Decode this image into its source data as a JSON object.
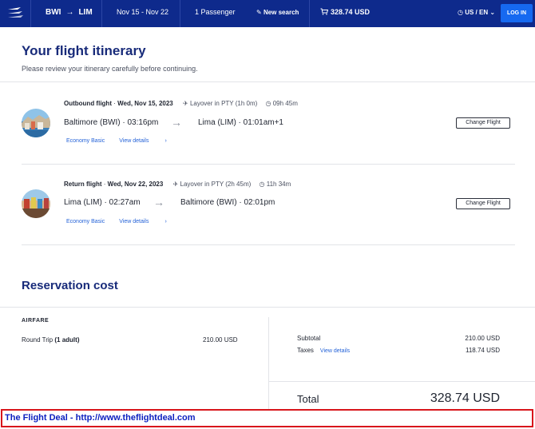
{
  "header": {
    "origin": "BWI",
    "destination": "LIM",
    "dates": "Nov 15 - Nov 22",
    "passengers": "1 Passenger",
    "new_search": "New search",
    "cart_total": "328.74 USD",
    "language": "US / EN",
    "login": "LOG IN",
    "brand_color": "#0e2a8c"
  },
  "itinerary": {
    "title": "Your flight itinerary",
    "subtitle": "Please review your itinerary carefully before continuing."
  },
  "flights": [
    {
      "label": "Outbound flight",
      "date": "Wed, Nov 15, 2023",
      "layover": "Layover in PTY (1h 0m)",
      "duration": "09h 45m",
      "from": "Baltimore (BWI) · 03:16pm",
      "to": "Lima (LIM) · 01:01am+1",
      "fare": "Economy Basic",
      "details": "View details",
      "change": "Change Flight"
    },
    {
      "label": "Return flight",
      "date": "Wed, Nov 22, 2023",
      "layover": "Layover in PTY (2h 45m)",
      "duration": "11h 34m",
      "from": "Lima (LIM) · 02:27am",
      "to": "Baltimore (BWI) · 02:01pm",
      "fare": "Economy Basic",
      "details": "View details",
      "change": "Change Flight"
    }
  ],
  "cost": {
    "title": "Reservation cost",
    "airfare_label": "AIRFARE",
    "round_trip_label": "Round Trip",
    "round_trip_pax": "(1 adult)",
    "round_trip_value": "210.00 USD",
    "subtotal_label": "Subtotal",
    "subtotal_value": "210.00 USD",
    "taxes_label": "Taxes",
    "taxes_link": "View details",
    "taxes_value": "118.74 USD",
    "total_label": "Total",
    "total_value": "328.74 USD"
  },
  "banner": {
    "text": "The Flight Deal - http://www.theflightdeal.com"
  }
}
